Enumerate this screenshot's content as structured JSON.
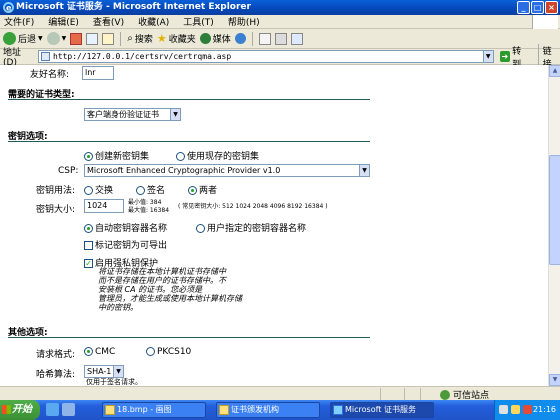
{
  "window": {
    "title": "Microsoft 证书服务 - Microsoft Internet Explorer",
    "buttons": [
      "_",
      "□",
      "×"
    ]
  },
  "menu": [
    "文件(F)",
    "编辑(E)",
    "查看(V)",
    "收藏(A)",
    "工具(T)",
    "帮助(H)"
  ],
  "toolbar": {
    "back": "后退",
    "search": "搜索",
    "favorites": "收藏夹",
    "media": "媒体"
  },
  "address": {
    "label": "地址(D)",
    "value": "http://127.0.0.1/certsrv/certrqma.asp",
    "go": "转到",
    "links": "链接"
  },
  "form": {
    "friendly_name_label": "友好名称:",
    "friendly_name_value": "lnr",
    "cert_type_title": "需要的证书类型:",
    "cert_type_value": "客户端身份验证证书",
    "key_options_title": "密钥选项:",
    "key_set_new": "创建新密钥集",
    "key_set_existing": "使用现存的密钥集",
    "csp_label": "CSP:",
    "csp_value": "Microsoft Enhanced Cryptographic Provider v1.0",
    "key_usage_label": "密钥用法:",
    "usage_exchange": "交换",
    "usage_signature": "签名",
    "usage_both": "两者",
    "key_size_label": "密钥大小:",
    "key_size_value": "1024",
    "key_size_min": "最小值: 384",
    "key_size_max": "最大值: 16384",
    "key_size_common": "( 常见密钥大小: 512 1024 2048 4096 8192 16384 )",
    "container_auto": "自动密钥容器名称",
    "container_user": "用户指定的密钥容器名称",
    "mark_exportable": "标记密钥为可导出",
    "strong_protection": "启用强私钥保护",
    "strong_protection_note": "将证书存储在本地计算机证书存储中\n而不是存储在用户的证书存储中。不\n安装根 CA 的证书。您必须是\n管理员，才能生成或使用本地计算机存储\n中的密钥。",
    "other_options_title": "其他选项:",
    "request_format_label": "请求格式:",
    "format_cmc": "CMC",
    "format_pkcs10": "PKCS10",
    "hash_label": "哈希算法:",
    "hash_value": "SHA-1",
    "hash_note": "仅用于签名请求。"
  },
  "status": {
    "zone": "可信站点"
  },
  "taskbar": {
    "start": "开始",
    "tasks": [
      "18.bmp - 画图",
      "证书颁发机构",
      "Microsoft 证书服务"
    ],
    "clock": "21:16"
  }
}
